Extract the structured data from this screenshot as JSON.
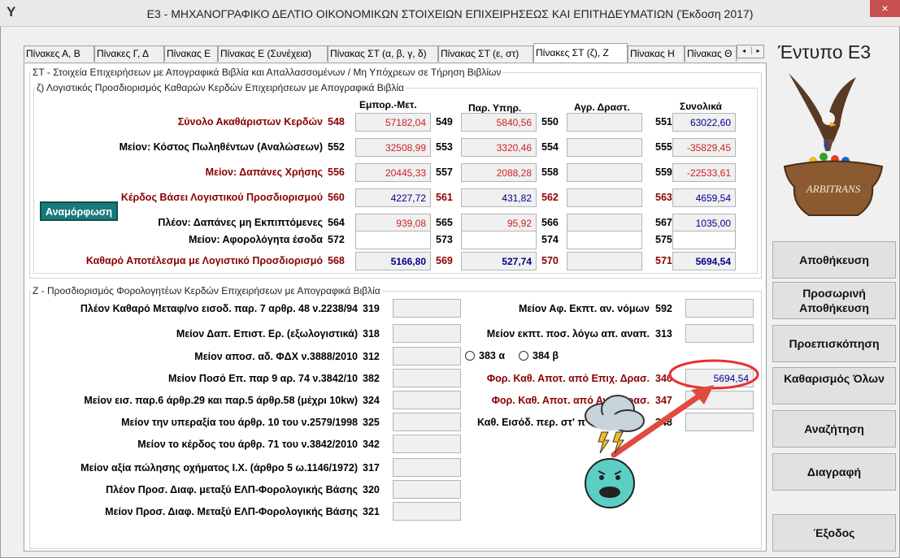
{
  "window": {
    "title": "E3 - ΜΗΧΑΝΟΓΡΑΦΙΚΟ ΔΕΛΤΙΟ ΟΙΚΟΝΟΜΙΚΩΝ ΣΤΟΙΧΕΙΩΝ ΕΠΙΧΕΙΡΗΣΕΩΣ ΚΑΙ ΕΠΙΤΗΔΕΥΜΑΤΙΩΝ (Έκδοση 2017)",
    "close": "×",
    "app_icon": "Y"
  },
  "tabs": [
    "Πίνακες Α, Β",
    "Πίνακες Γ, Δ",
    "Πίνακας Ε",
    "Πίνακας Ε (Συνέχεια)",
    "Πίνακας ΣΤ (α, β, γ, δ)",
    "Πίνακας ΣΤ (ε, στ)",
    "Πίνακες ΣΤ (ζ), Ζ",
    "Πίνακας Η",
    "Πίνακας Θ"
  ],
  "tab_arrows": {
    "left": "◂",
    "right": "▸"
  },
  "section_st": {
    "title": "ΣΤ - Στοιχεία Επιχειρήσεων με Απογραφικά Βιβλία και Απαλλασσομένων / Μη Υπόχρεων σε Τήρηση Βιβλίων",
    "sub_title": "ζ) Λογιστικός Προσδιορισμός Καθαρών Κερδών Επιχειρήσεων με Απογραφικά Βιβλία",
    "col_headers": [
      "Εμπορ.-Μετ.",
      "Παρ. Υπηρ.",
      "Αγρ. Δραστ.",
      "Συνολικά"
    ],
    "rows": [
      {
        "label": "Σύνολο Ακαθάριστων Κερδών",
        "codes": [
          "548",
          "549",
          "550",
          "551"
        ],
        "values": [
          "57182,04",
          "5840,56",
          "",
          "63022,60"
        ]
      },
      {
        "label": "Μείον: Κόστος Πωληθέντων (Αναλώσεων)",
        "codes": [
          "552",
          "553",
          "554",
          "555"
        ],
        "values": [
          "32508,99",
          "3320,46",
          "",
          "-35829,45"
        ]
      },
      {
        "label": "Μείον: Δαπάνες Χρήσης",
        "codes": [
          "556",
          "557",
          "558",
          "559"
        ],
        "values": [
          "20445,33",
          "2088,28",
          "",
          "-22533,61"
        ]
      },
      {
        "label": "Κέρδος Βάσει Λογιστικού Προσδιορισμού",
        "codes": [
          "560",
          "561",
          "562",
          "563"
        ],
        "values": [
          "4227,72",
          "431,82",
          "",
          "4659,54"
        ]
      },
      {
        "label": "Πλέον: Δαπάνες μη Εκπιπτόμενες",
        "codes": [
          "564",
          "565",
          "566",
          "567"
        ],
        "values": [
          "939,08",
          "95,92",
          "",
          "1035,00"
        ]
      },
      {
        "label": "Μείον: Αφορολόγητα έσοδα",
        "codes": [
          "572",
          "573",
          "574",
          "575"
        ],
        "values": [
          "",
          "",
          "",
          ""
        ]
      },
      {
        "label": "Καθαρό Αποτέλεσμα με Λογιστικό Προσδιορισμό",
        "codes": [
          "568",
          "569",
          "570",
          "571"
        ],
        "values": [
          "5166,80",
          "527,74",
          "",
          "5694,54"
        ]
      }
    ],
    "anamorfosi": "Αναμόρφωση"
  },
  "section_z": {
    "title": "Ζ - Προσδιορισμός Φορολογητέων Κερδών Επιχειρήσεων με Απογραφικά Βιβλία",
    "left_rows": [
      {
        "label": "Πλέον Καθαρό Μεταφ/νο εισοδ. παρ. 7 αρθρ. 48 ν.2238/94",
        "code": "319",
        "value": ""
      },
      {
        "label": "Μείον Δαπ. Επιστ. Ερ. (εξωλογιστικά)",
        "code": "318",
        "value": ""
      },
      {
        "label": "Μείον αποσ. αδ. ΦΔΧ ν.3888/2010",
        "code": "312",
        "value": ""
      },
      {
        "label": "Μείον Ποσό Επ. παρ 9 αρ. 74 ν.3842/10",
        "code": "382",
        "value": ""
      },
      {
        "label": "Μείον εισ. παρ.6 άρθρ.29 και παρ.5 άρθρ.58 (μέχρι 10kw)",
        "code": "324",
        "value": ""
      },
      {
        "label": "Μείον την υπεραξία του άρθρ. 10 του ν.2579/1998",
        "code": "325",
        "value": ""
      },
      {
        "label": "Μείον το κέρδος του άρθρ. 71 του ν.3842/2010",
        "code": "342",
        "value": ""
      },
      {
        "label": "Μείον αξία πώλησης οχήματος Ι.Χ. (άρθρο 5 ω.1146/1972)",
        "code": "317",
        "value": ""
      },
      {
        "label": "Πλέον Προσ. Διαφ. μεταξύ ΕΛΠ-Φορολογικής Βάσης",
        "code": "320",
        "value": ""
      },
      {
        "label": "Μείον Προσ. Διαφ. Μεταξύ ΕΛΠ-Φορολογικής Βάσης",
        "code": "321",
        "value": ""
      }
    ],
    "right_rows": [
      {
        "label": "Μείον Αφ. Εκπτ. αν. νόμων",
        "code": "592",
        "value": ""
      },
      {
        "label": "Μείον εκπτ. ποσ. λόγω απ. αναπ.",
        "code": "313",
        "value": ""
      },
      {
        "label": "Φορ. Καθ. Αποτ. από Επιχ. Δρασ.",
        "code": "346",
        "value": "5694,54"
      },
      {
        "label": "Φορ. Καθ. Αποτ. από Αγρ. Δρασ.",
        "code": "347",
        "value": ""
      },
      {
        "label": "Καθ. Εισόδ. περ. στ' π",
        "code": "348",
        "value": ""
      }
    ],
    "radio_383": "383 α",
    "radio_384": "384 β"
  },
  "sidebar": {
    "brand": "Έντυπο Ε3",
    "pot_text": "ARBITRANS",
    "buttons": [
      "Αποθήκευση",
      "Προσωρινή Αποθήκευση",
      "Προεπισκόπηση",
      "Καθαρισμός Όλων",
      "Αναζήτηση",
      "Διαγραφή",
      "Έξοδος"
    ]
  },
  "colors": {
    "accent_red": "#e83030",
    "teal": "#1a7a7a",
    "dark_red_label": "#8b0000",
    "value_blue": "#00008b"
  }
}
